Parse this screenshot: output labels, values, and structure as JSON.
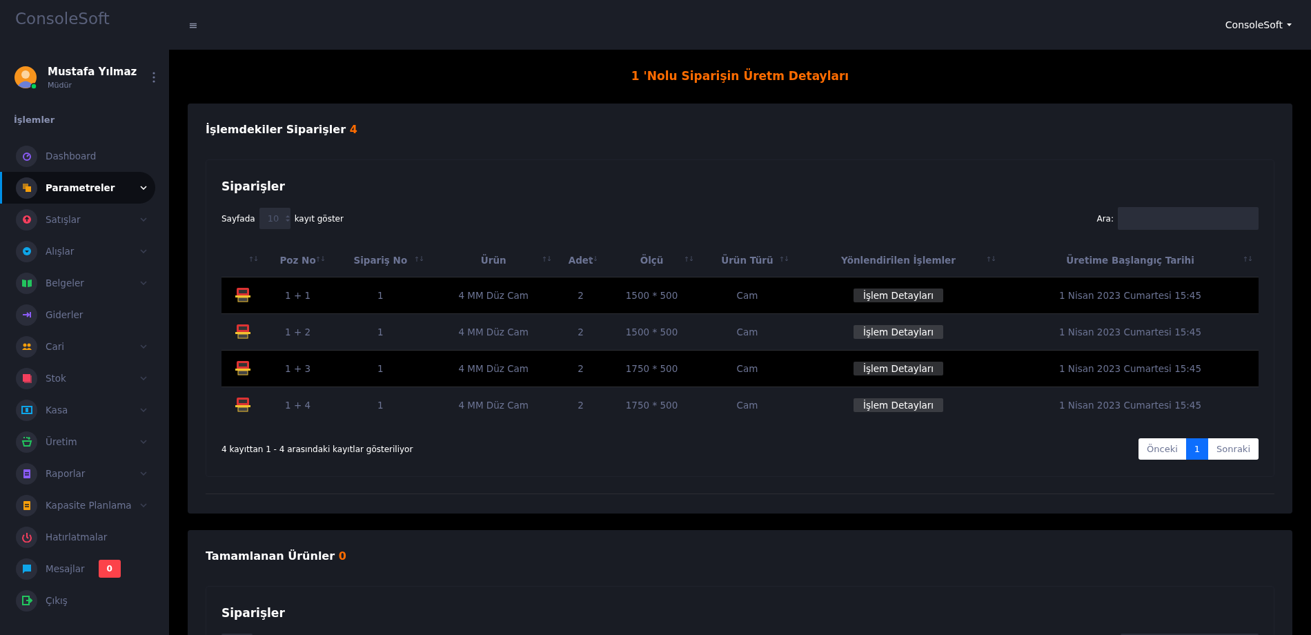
{
  "brand": "ConsoleSoft",
  "topbar": {
    "menu_glyph": "≡",
    "user_menu": "ConsoleSoft"
  },
  "user": {
    "name": "Mustafa Yılmaz",
    "role": "Müdür",
    "online": true
  },
  "sidebar": {
    "heading": "İşlemler",
    "items": [
      {
        "label": "Dashboard",
        "selected": false,
        "expandable": false
      },
      {
        "label": "Parametreler",
        "selected": true,
        "expandable": true
      },
      {
        "label": "Satışlar",
        "selected": false,
        "expandable": true
      },
      {
        "label": "Alışlar",
        "selected": false,
        "expandable": true
      },
      {
        "label": "Belgeler",
        "selected": false,
        "expandable": true
      },
      {
        "label": "Giderler",
        "selected": false,
        "expandable": false
      },
      {
        "label": "Cari",
        "selected": false,
        "expandable": true
      },
      {
        "label": "Stok",
        "selected": false,
        "expandable": true
      },
      {
        "label": "Kasa",
        "selected": false,
        "expandable": true
      },
      {
        "label": "Üretim",
        "selected": false,
        "expandable": true
      },
      {
        "label": "Raporlar",
        "selected": false,
        "expandable": true
      },
      {
        "label": "Kapasite Planlama",
        "selected": false,
        "expandable": true
      },
      {
        "label": "Hatırlatmalar",
        "selected": false,
        "expandable": false
      },
      {
        "label": "Mesajlar",
        "selected": false,
        "expandable": false,
        "badge": "0"
      },
      {
        "label": "Çıkış",
        "selected": false,
        "expandable": false
      }
    ]
  },
  "page_title": "1 'Nolu Siparişin Üretm Detayları",
  "sections": [
    {
      "title": "İşlemdekiler Siparişler",
      "count": "4",
      "table_card": {
        "title": "Siparişler",
        "length_prefix": "Sayfada",
        "length_value": "10",
        "length_suffix": "kayıt göster",
        "search_label": "Ara:",
        "columns": [
          "Poz No",
          "Sipariş No",
          "Ürün",
          "Adet",
          "Ölçü",
          "Ürün Türü",
          "Yönlendirilen İşlemler",
          "Üretime Başlangıç Tarihi"
        ],
        "rows": [
          {
            "poz_no": "1 + 1",
            "siparis_no": "1",
            "urun": "4 MM Düz Cam",
            "adet": "2",
            "olcu": "1500 * 500",
            "urun_turu": "Cam",
            "action": "İşlem Detayları",
            "date": "1 Nisan 2023 Cumartesi 15:45"
          },
          {
            "poz_no": "1 + 2",
            "siparis_no": "1",
            "urun": "4 MM Düz Cam",
            "adet": "2",
            "olcu": "1500 * 500",
            "urun_turu": "Cam",
            "action": "İşlem Detayları",
            "date": "1 Nisan 2023 Cumartesi 15:45"
          },
          {
            "poz_no": "1 + 3",
            "siparis_no": "1",
            "urun": "4 MM Düz Cam",
            "adet": "2",
            "olcu": "1750 * 500",
            "urun_turu": "Cam",
            "action": "İşlem Detayları",
            "date": "1 Nisan 2023 Cumartesi 15:45"
          },
          {
            "poz_no": "1 + 4",
            "siparis_no": "1",
            "urun": "4 MM Düz Cam",
            "adet": "2",
            "olcu": "1750 * 500",
            "urun_turu": "Cam",
            "action": "İşlem Detayları",
            "date": "1 Nisan 2023 Cumartesi 15:45"
          }
        ],
        "info": "4 kayıttan 1 - 4 arasındaki kayıtlar gösteriliyor",
        "pagination": {
          "previous": "Önceki",
          "pages": [
            {
              "label": "1",
              "selected": true
            }
          ],
          "next": "Sonraki"
        }
      }
    },
    {
      "title": "Tamamlanan Ürünler",
      "count": "0",
      "table_card": {
        "title": "Siparişler"
      }
    }
  ]
}
